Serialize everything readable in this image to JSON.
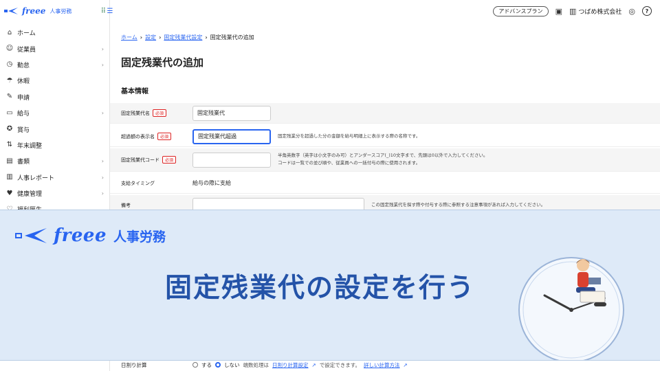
{
  "app": {
    "brand": "freee",
    "brand_sub": "人事労務"
  },
  "sidebar": {
    "items": [
      {
        "label": "ホーム",
        "icon": "home-icon",
        "arrow": false
      },
      {
        "label": "従業員",
        "icon": "employee-icon",
        "arrow": true
      },
      {
        "label": "勤怠",
        "icon": "attendance-icon",
        "arrow": true
      },
      {
        "label": "休暇",
        "icon": "vacation-icon",
        "arrow": false
      },
      {
        "label": "申請",
        "icon": "application-icon",
        "arrow": false
      },
      {
        "label": "給与",
        "icon": "salary-icon",
        "arrow": true
      },
      {
        "label": "賞与",
        "icon": "bonus-icon",
        "arrow": false
      },
      {
        "label": "年末調整",
        "icon": "year-end-icon",
        "arrow": false
      },
      {
        "label": "書類",
        "icon": "document-icon",
        "arrow": true
      },
      {
        "label": "人事レポート",
        "icon": "report-icon",
        "arrow": true
      },
      {
        "label": "健康管理",
        "icon": "health-icon",
        "arrow": true
      },
      {
        "label": "福利厚生",
        "icon": "welfare-icon",
        "arrow": false
      }
    ]
  },
  "topbar": {
    "plan": "アドバンスプラン",
    "company": "つばめ株式会社"
  },
  "breadcrumb": {
    "home": "ホーム",
    "settings": "設定",
    "overtime_settings": "固定残業代設定",
    "current": "固定残業代の追加"
  },
  "page": {
    "title": "固定残業代の追加",
    "section": "基本情報"
  },
  "form": {
    "required": "必須",
    "name_label": "固定残業代名",
    "name_value": "固定残業代",
    "display_label": "超過額の表示名",
    "display_value": "固定残業代超過",
    "display_hint": "固定残業分を超過した分の金額を給与明細上に表示する際の名称です。",
    "code_label": "固定残業代コード",
    "code_value": "",
    "code_hint_1": "半角英数字（英字は小文字のみ可）とアンダースコア(_)10文字まで、先頭は0以外で入力してください。",
    "code_hint_2": "コードは一覧での並び順や、従業員への一括付与の際に使用されます。",
    "timing_label": "支給タイミング",
    "timing_value": "給与の際に支給",
    "note_label": "備考",
    "note_value": "",
    "note_hint": "この固定残業代を探す際や付与する際に参照する注意事項があれば入力してください。",
    "daily_label": "日割り計算",
    "daily_yes": "する",
    "daily_no": "しない",
    "daily_hint_pre": "端数処理は",
    "daily_hint_link": "日割り計算設定",
    "daily_hint_post": "で設定できます。",
    "daily_hint_link2": "詳しい計算方法"
  },
  "banner": {
    "logo": "freee",
    "logo_sub": "人事労務",
    "headline": "固定残業代の設定を行う"
  },
  "colors": {
    "brand": "#2864f0",
    "banner_bg": "#deeaf8",
    "headline": "#2453a8",
    "required": "#dd2222"
  }
}
